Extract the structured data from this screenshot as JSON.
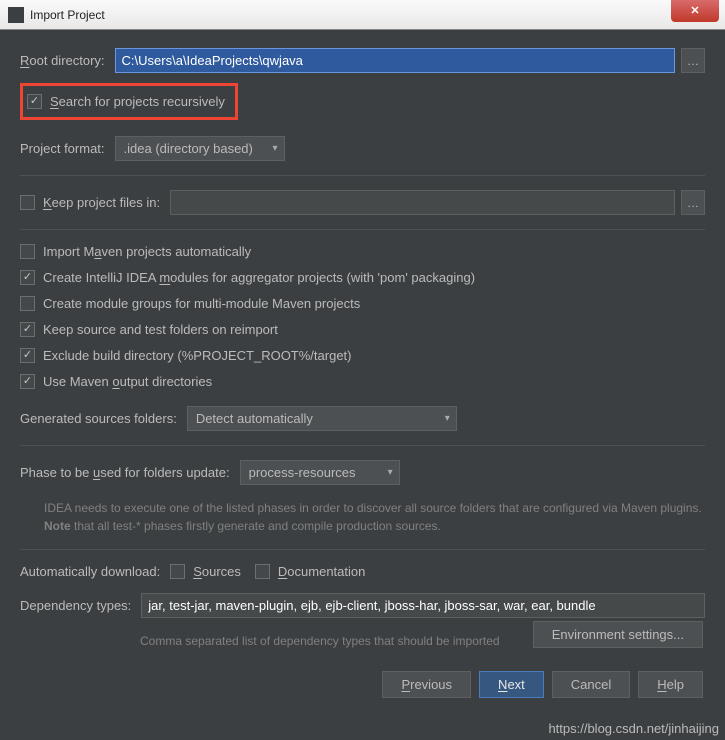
{
  "window": {
    "title": "Import Project"
  },
  "rootDir": {
    "label": "Root directory:",
    "value": "C:\\Users\\a\\IdeaProjects\\qwjava"
  },
  "searchRecursive": {
    "label": "Search for projects recursively"
  },
  "projectFormat": {
    "label": "Project format:",
    "value": ".idea (directory based)"
  },
  "keepFiles": {
    "label": "Keep project files in:"
  },
  "opts": {
    "importAuto": "Import Maven projects automatically",
    "createModules": "Create IntelliJ IDEA modules for aggregator projects (with 'pom' packaging)",
    "createGroups": "Create module groups for multi-module Maven projects",
    "keepSource": "Keep source and test folders on reimport",
    "excludeBuild": "Exclude build directory (%PROJECT_ROOT%/target)",
    "useMavenOut": "Use Maven output directories"
  },
  "genSources": {
    "label": "Generated sources folders:",
    "value": "Detect automatically"
  },
  "phase": {
    "label": "Phase to be used for folders update:",
    "value": "process-resources",
    "help1": "IDEA needs to execute one of the listed phases in order to discover all source folders that are configured via Maven plugins.",
    "help2a": "Note",
    "help2b": " that all test-* phases firstly generate and compile production sources."
  },
  "autoDownload": {
    "label": "Automatically download:",
    "sources": "Sources",
    "docs": "Documentation"
  },
  "depTypes": {
    "label": "Dependency types:",
    "value": "jar, test-jar, maven-plugin, ejb, ejb-client, jboss-har, jboss-sar, war, ear, bundle",
    "help": "Comma separated list of dependency types that should be imported"
  },
  "envBtn": "Environment settings...",
  "buttons": {
    "prev": "Previous",
    "next": "Next",
    "cancel": "Cancel",
    "help": "Help"
  },
  "watermark": "https://blog.csdn.net/jinhaijing"
}
